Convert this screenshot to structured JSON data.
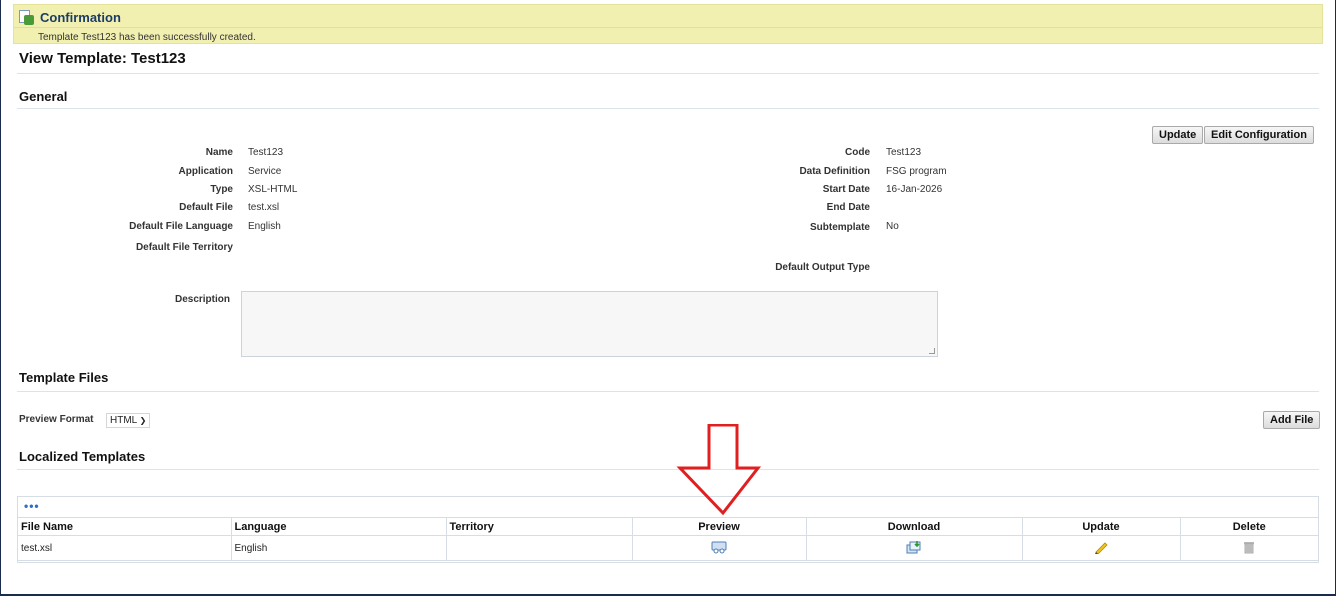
{
  "confirmation": {
    "title": "Confirmation",
    "message": "Template Test123 has been successfully created."
  },
  "page_title": "View Template: Test123",
  "general": {
    "section_title": "General",
    "buttons": {
      "update": "Update",
      "edit_configuration": "Edit Configuration"
    },
    "left_fields": [
      {
        "label": "Name",
        "value": "Test123"
      },
      {
        "label": "Application",
        "value": "Service"
      },
      {
        "label": "Type",
        "value": "XSL-HTML"
      },
      {
        "label": "Default File",
        "value": "test.xsl"
      },
      {
        "label": "Default File Language",
        "value": "English"
      },
      {
        "label": "Default File Territory",
        "value": ""
      }
    ],
    "right_fields": [
      {
        "label": "Code",
        "value": "Test123"
      },
      {
        "label": "Data Definition",
        "value": "FSG program"
      },
      {
        "label": "Start Date",
        "value": "16-Jan-2026"
      },
      {
        "label": "End Date",
        "value": ""
      },
      {
        "label": "Subtemplate",
        "value": "No"
      },
      {
        "label": "Default Output Type",
        "value": ""
      }
    ],
    "description_label": "Description",
    "description_value": ""
  },
  "template_files": {
    "section_title": "Template Files",
    "preview_format_label": "Preview Format",
    "preview_format_value": "HTML",
    "add_file_button": "Add File"
  },
  "localized_templates": {
    "section_title": "Localized Templates",
    "more_indicator": "•••",
    "columns": [
      "File Name",
      "Language",
      "Territory",
      "Preview",
      "Download",
      "Update",
      "Delete"
    ],
    "rows": [
      {
        "file_name": "test.xsl",
        "language": "English",
        "territory": "",
        "preview_icon": "preview-icon",
        "download_icon": "download-icon",
        "update_icon": "pencil-icon",
        "delete_icon": "trash-icon"
      }
    ]
  },
  "colors": {
    "confirmation_bg": "#f2f0b1",
    "annotation_arrow": "#e02020",
    "link_blue": "#2f6ec9"
  }
}
